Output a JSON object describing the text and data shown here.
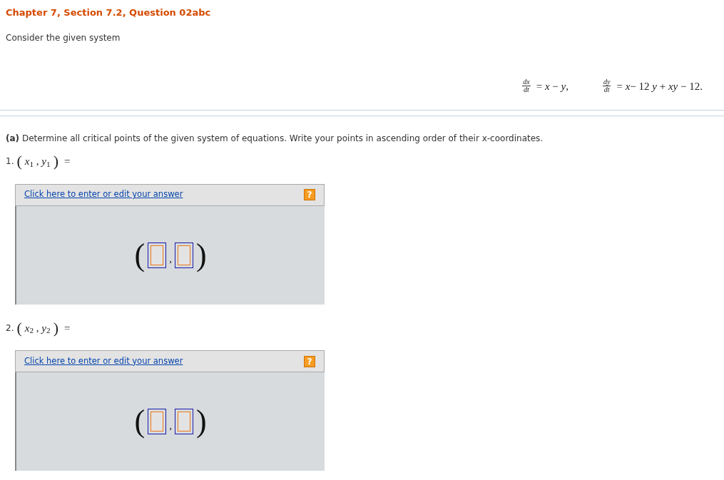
{
  "header": {
    "title": "Chapter 7, Section 7.2, Question 02abc",
    "intro": "Consider the given system"
  },
  "equations": [
    {
      "numerator": "dx",
      "denominator": "dt",
      "rhs": "= *x* − *y*,"
    },
    {
      "numerator": "dy",
      "denominator": "dt",
      "rhs": "= *x*− 12 *y* + *xy* − 12."
    }
  ],
  "part_a": {
    "label": "(a)",
    "text": "Determine all critical points of the given system of equations. Write your points in ascending order of their x-coordinates."
  },
  "points": [
    {
      "number": "1.",
      "expression": "*x*$_{1}$ , *y*$_{1}$",
      "equals": "=",
      "answer": {
        "link": "Click here to enter or edit your answer",
        "help": "?",
        "open": "(",
        "separator": ",",
        "close": ")"
      }
    },
    {
      "number": "2.",
      "expression": "*x*$_{2}$ , *y*$_{2}$",
      "equals": "=",
      "answer": {
        "link": "Click here to enter or edit your answer",
        "help": "?",
        "open": "(",
        "separator": ",",
        "close": ")"
      }
    }
  ]
}
